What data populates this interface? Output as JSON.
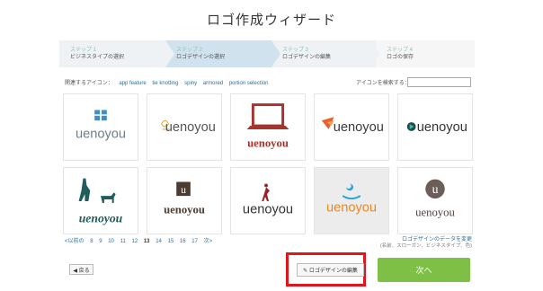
{
  "page": {
    "title": "ロゴ作成ウィザード"
  },
  "steps": [
    {
      "num": "ステップ 1",
      "name": "ビジネスタイプの選択"
    },
    {
      "num": "ステップ 2",
      "name": "ロゴデザインの選択"
    },
    {
      "num": "ステップ 3",
      "name": "ロゴデザインの編集"
    },
    {
      "num": "ステップ 4",
      "name": "ロゴの保存"
    }
  ],
  "filters": {
    "related_label": "関連するアイコン：",
    "tags": [
      "app feature",
      "tie knotting",
      "spiny",
      "armored",
      "portion selection"
    ],
    "search_label": "アイコンを検索する：",
    "search_value": ""
  },
  "tiles": [
    {
      "text": "uenoyou",
      "color": "#6e7f86"
    },
    {
      "text": "uenoyou",
      "color": "#555555"
    },
    {
      "text": "uenoyou",
      "color": "#a8332d"
    },
    {
      "text": "uenoyou",
      "color": "#3a3a3a"
    },
    {
      "text": "uenoyou",
      "color": "#333333"
    },
    {
      "text": "uenoyou",
      "color": "#1f5e5b"
    },
    {
      "text": "uenoyou",
      "color": "#4b3b30"
    },
    {
      "text": "uenoyou",
      "color": "#333333"
    },
    {
      "text": "uenoyou",
      "color": "#e28a2a"
    },
    {
      "text": "uenoyou",
      "color": "#4b3f3a"
    }
  ],
  "pagination": {
    "prev": "<以前の",
    "pages": [
      "8",
      "9",
      "10",
      "11",
      "12",
      "13",
      "14",
      "15",
      "16",
      "17"
    ],
    "current": "13",
    "next": "次>"
  },
  "change_data": {
    "link": "ロゴデザインのデータを変更",
    "sub": "(名前、スローガン、ビジネスタイプ、色)"
  },
  "buttons": {
    "back": "◀ 戻る",
    "edit": "✎ ロゴデザインの編集",
    "next": "次へ"
  }
}
